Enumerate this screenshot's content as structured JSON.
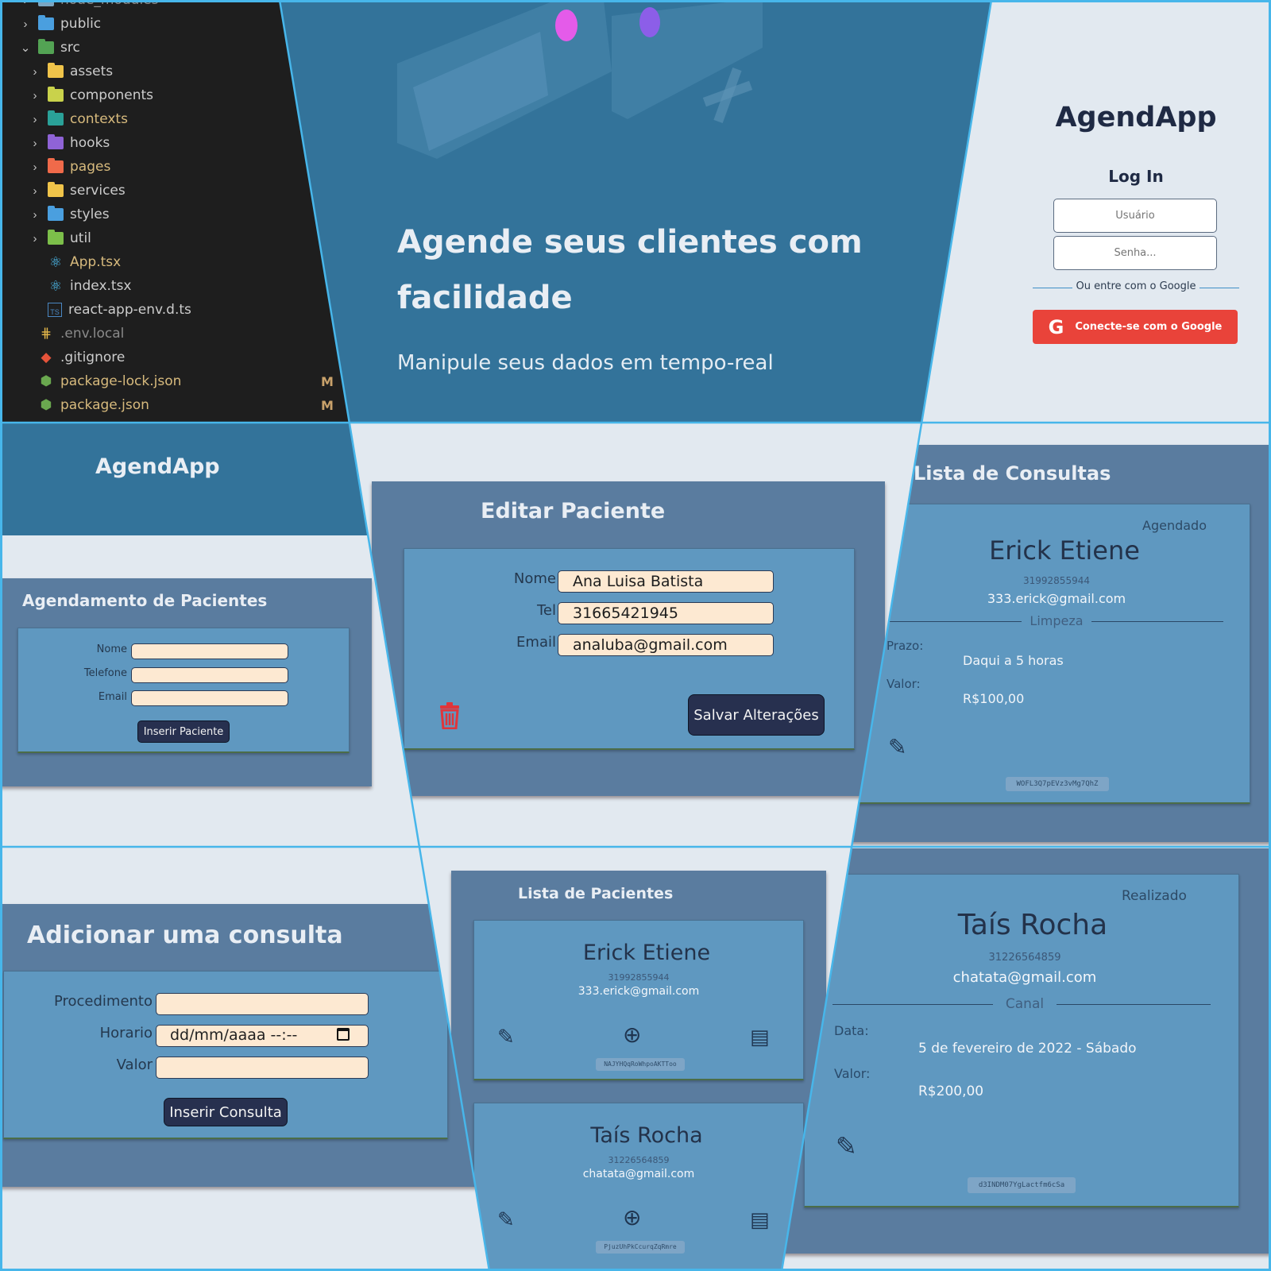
{
  "explorer": {
    "items": [
      {
        "label": "node_modules",
        "type": "folder",
        "color": "#7aa6c2",
        "chevron": "›",
        "muted": true
      },
      {
        "label": "public",
        "type": "folder",
        "color": "#4a9fdf",
        "chevron": "›"
      },
      {
        "label": "src",
        "type": "folder",
        "color": "#53a354",
        "chevron": "⌄"
      },
      {
        "label": "assets",
        "type": "folder",
        "color": "#f0c44a",
        "chevron": "›"
      },
      {
        "label": "components",
        "type": "folder",
        "color": "#c9d24b",
        "chevron": "›"
      },
      {
        "label": "contexts",
        "type": "folder",
        "color": "#2aa198",
        "chevron": "›",
        "label_color": "#d7ba7d"
      },
      {
        "label": "hooks",
        "type": "folder",
        "color": "#8f63d6",
        "chevron": "›"
      },
      {
        "label": "pages",
        "type": "folder",
        "color": "#f06a4a",
        "chevron": "›",
        "label_color": "#d7ba7d"
      },
      {
        "label": "services",
        "type": "folder",
        "color": "#f0c44a",
        "chevron": "›"
      },
      {
        "label": "styles",
        "type": "folder",
        "color": "#4a9fdf",
        "chevron": "›"
      },
      {
        "label": "util",
        "type": "folder",
        "color": "#7cbf4a",
        "chevron": "›"
      },
      {
        "label": "App.tsx",
        "type": "react",
        "label_color": "#d7ba7d"
      },
      {
        "label": "index.tsx",
        "type": "react"
      },
      {
        "label": "react-app-env.d.ts",
        "type": "ts"
      },
      {
        "label": ".env.local",
        "type": "env",
        "muted": true
      },
      {
        "label": ".gitignore",
        "type": "git"
      },
      {
        "label": "package-lock.json",
        "type": "node",
        "label_color": "#d7ba7d",
        "badge": "M"
      },
      {
        "label": "package.json",
        "type": "node",
        "label_color": "#d7ba7d",
        "badge": "M"
      }
    ]
  },
  "hero": {
    "title": "Agende seus clientes com facilidade",
    "subtitle": "Manipule seus dados em tempo-real"
  },
  "login": {
    "app_name": "AgendApp",
    "title": "Log In",
    "user_placeholder": "Usuário",
    "password_placeholder": "Senha...",
    "or_text": "Ou entre com o Google",
    "google_button": "Conecte-se com o Google"
  },
  "sidebar": {
    "app_name": "AgendApp"
  },
  "agendamento": {
    "title": "Agendamento de Pacientes",
    "labels": {
      "nome": "Nome",
      "telefone": "Telefone",
      "email": "Email"
    },
    "button": "Inserir Paciente"
  },
  "editar": {
    "title": "Editar Paciente",
    "labels": {
      "nome": "Nome",
      "tel": "Tel",
      "email": "Email"
    },
    "values": {
      "nome": "Ana Luisa Batista",
      "tel": "31665421945",
      "email": "analuba@gmail.com"
    },
    "button": "Salvar Alterações"
  },
  "consultas": {
    "title": "Lista de Consultas",
    "card": {
      "status": "Agendado",
      "name": "Erick Etiene",
      "phone": "31992855944",
      "email": "333.erick@gmail.com",
      "procedure": "Limpeza",
      "prazo_label": "Prazo:",
      "prazo_value": "Daqui a 5 horas",
      "valor_label": "Valor:",
      "valor_value": "R$100,00",
      "id": "WOFL3Q7pEVz3vMg7QhZ"
    }
  },
  "adicionar": {
    "title": "Adicionar uma consulta",
    "labels": {
      "procedimento": "Procedimento",
      "horario": "Horario",
      "valor": "Valor"
    },
    "date_placeholder": "dd/mm/aaaa --:--",
    "button": "Inserir Consulta"
  },
  "pacientes": {
    "title": "Lista de Pacientes",
    "items": [
      {
        "name": "Erick Etiene",
        "phone": "31992855944",
        "email": "333.erick@gmail.com",
        "id": "NAJYHQqRoWhpoAKTToo"
      },
      {
        "name": "Taís Rocha",
        "phone": "31226564859",
        "email": "chatata@gmail.com",
        "id": "PjuzUhPkCcurqZqRmre"
      }
    ]
  },
  "realizada": {
    "status": "Realizado",
    "name": "Taís Rocha",
    "phone": "31226564859",
    "email": "chatata@gmail.com",
    "procedure": "Canal",
    "data_label": "Data:",
    "data_value": "5 de fevereiro de 2022 - Sábado",
    "valor_label": "Valor:",
    "valor_value": "R$200,00",
    "id": "d3INDM07YgLactfm6cSa"
  },
  "colors": {
    "primary_blue": "#33739a",
    "card_outer": "#5a7c9f",
    "card_inner": "#5f98c0",
    "input_fill": "#fde9d2",
    "dark_button": "#27304f",
    "google_red": "#e9433a",
    "trash_red": "#e0353b",
    "separator": "#47b6ea"
  }
}
